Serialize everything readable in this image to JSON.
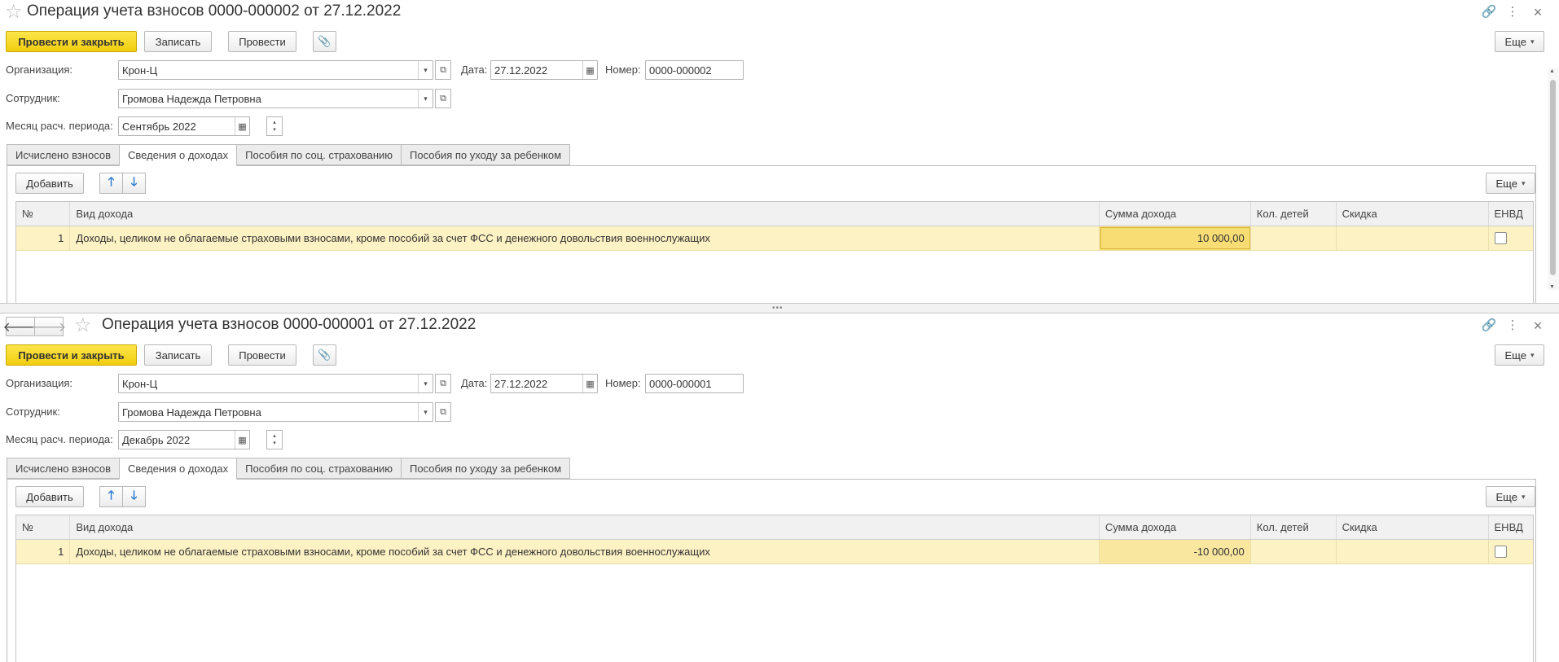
{
  "top": {
    "title": "Операция учета взносов 0000-000002 от 27.12.2022",
    "toolbar": {
      "post_close": "Провести и закрыть",
      "save": "Записать",
      "post": "Провести",
      "more": "Еще"
    },
    "form": {
      "org_label": "Организация:",
      "org_value": "Крон-Ц",
      "date_label": "Дата:",
      "date_value": "27.12.2022",
      "number_label": "Номер:",
      "number_value": "0000-000002",
      "employee_label": "Сотрудник:",
      "employee_value": "Громова Надежда Петровна",
      "period_label": "Месяц расч. периода:",
      "period_value": "Сентябрь 2022"
    },
    "tabs": [
      "Исчислено взносов",
      "Сведения о доходах",
      "Пособия по соц. страхованию",
      "Пособия по уходу за ребенком"
    ],
    "active_tab": 1,
    "table_toolbar": {
      "add": "Добавить",
      "more": "Еще"
    },
    "table": {
      "columns": [
        "№",
        "Вид дохода",
        "Сумма дохода",
        "Кол. детей",
        "Скидка",
        "ЕНВД"
      ],
      "rows": [
        {
          "num": "1",
          "type": "Доходы, целиком не облагаемые страховыми взносами, кроме пособий за счет ФСС и денежного довольствия военнослужащих",
          "sum": "10 000,00",
          "kids": "",
          "discount": "",
          "envd": false
        }
      ]
    }
  },
  "bottom": {
    "title": "Операция учета взносов 0000-000001 от 27.12.2022",
    "toolbar": {
      "post_close": "Провести и закрыть",
      "save": "Записать",
      "post": "Провести",
      "more": "Еще"
    },
    "form": {
      "org_label": "Организация:",
      "org_value": "Крон-Ц",
      "date_label": "Дата:",
      "date_value": "27.12.2022",
      "number_label": "Номер:",
      "number_value": "0000-000001",
      "employee_label": "Сотрудник:",
      "employee_value": "Громова Надежда Петровна",
      "period_label": "Месяц расч. периода:",
      "period_value": "Декабрь 2022"
    },
    "tabs": [
      "Исчислено взносов",
      "Сведения о доходах",
      "Пособия по соц. страхованию",
      "Пособия по уходу за ребенком"
    ],
    "active_tab": 1,
    "table_toolbar": {
      "add": "Добавить",
      "more": "Еще"
    },
    "table": {
      "columns": [
        "№",
        "Вид дохода",
        "Сумма дохода",
        "Кол. детей",
        "Скидка",
        "ЕНВД"
      ],
      "rows": [
        {
          "num": "1",
          "type": "Доходы, целиком не облагаемые страховыми взносами, кроме пособий за счет ФСС и денежного довольствия военнослужащих",
          "sum": "-10 000,00",
          "kids": "",
          "discount": "",
          "envd": false
        }
      ]
    }
  },
  "icons": {
    "favorite": "☆",
    "link": "🔗",
    "menu": "⋮",
    "close": "×",
    "attach": "📎",
    "back": "🡐",
    "forward": "🡒",
    "up": "🡑",
    "down": "🡓"
  },
  "colors": {
    "primary_button": "#f2cd0f",
    "selected_row": "#fdf2c4",
    "selected_cell": "#f7dd74",
    "arrow_blue": "#2f7cd0"
  }
}
